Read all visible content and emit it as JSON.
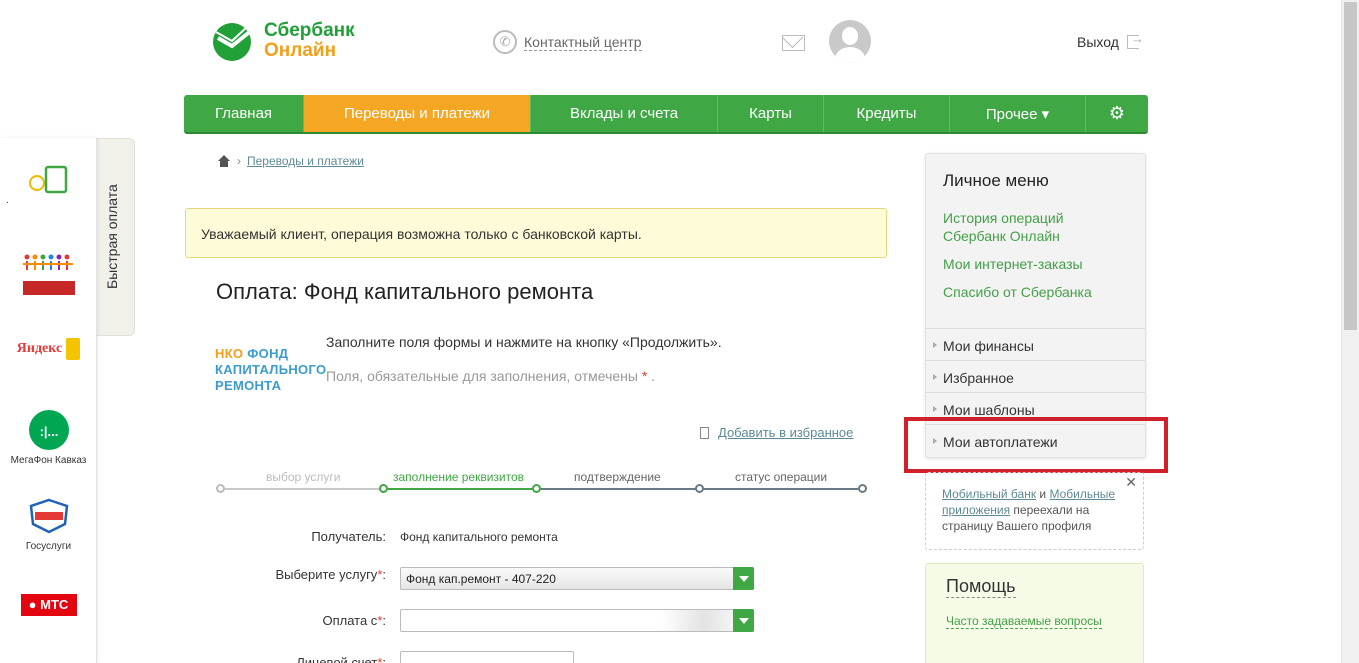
{
  "header": {
    "logo_line1": "Сбербанк",
    "logo_line2": "Онлайн",
    "contact_center": "Контактный центр",
    "logout": "Выход"
  },
  "nav": {
    "items": [
      {
        "label": "Главная"
      },
      {
        "label": "Переводы и платежи"
      },
      {
        "label": "Вклады и счета"
      },
      {
        "label": "Карты"
      },
      {
        "label": "Кредиты"
      },
      {
        "label": "Прочее ▾"
      }
    ],
    "active_index": 1,
    "accent": "#3fa844",
    "active_color": "#f5a623"
  },
  "quick_pay": {
    "title": "Быстрая оплата",
    "items": [
      {
        "label": ".",
        "icon": "mobile-payment-icon"
      },
      {
        "label": "",
        "icon": "charity-people-icon"
      },
      {
        "label": "Яндекс",
        "icon": "yandex-money-icon"
      },
      {
        "label": "МегаФон Кавказ",
        "icon": "megafon-icon"
      },
      {
        "label": "Госуслуги",
        "icon": "gosuslugi-icon"
      },
      {
        "label": "МТС",
        "icon": "mts-icon"
      }
    ]
  },
  "breadcrumb": {
    "link": "Переводы и платежи"
  },
  "notice": "Уважаемый клиент, операция возможна только с банковской карты.",
  "page_title": "Оплата: Фонд капитального ремонта",
  "provider_logo": {
    "line1_a": "НКО",
    "line1_b": " ФОНД",
    "line2": "КАПИТАЛЬНОГО",
    "line3": "РЕМОНТА"
  },
  "instructions": {
    "line1": "Заполните поля формы и нажмите на кнопку «Продолжить».",
    "line2": "Поля, обязательные для заполнения, отмечены",
    "required_mark": "*",
    "line2_end": " ."
  },
  "add_favorite": "Добавить в избранное",
  "steps": [
    {
      "label": "выбор услуги",
      "state": "done"
    },
    {
      "label": "заполнение реквизитов",
      "state": "current"
    },
    {
      "label": "подтверждение",
      "state": "todo"
    },
    {
      "label": "статус операции",
      "state": "todo"
    }
  ],
  "form": {
    "recipient_label": "Получатель:",
    "recipient_value": "Фонд капитального ремонта",
    "service_label": "Выберите услугу",
    "service_value": "Фонд кап.ремонт - 407-220",
    "pay_from_label": "Оплата с",
    "pay_from_value": "",
    "next_label": "Лицевой счет",
    "required_mark": "*"
  },
  "personal_menu": {
    "title": "Личное меню",
    "links": [
      "История операций Сбербанк Онлайн",
      "Мои интернет-заказы",
      "Спасибо от Сбербанка"
    ],
    "sections": [
      "Мои финансы",
      "Избранное",
      "Мои шаблоны",
      "Мои автоплатежи"
    ]
  },
  "tip": {
    "link1": "Мобильный банк",
    "and": " и ",
    "link2": "Мобильные приложения",
    "rest": " переехали на страницу Вашего профиля",
    "close": "✕"
  },
  "help": {
    "title": "Помощь",
    "faq": "Часто задаваемые вопросы"
  }
}
